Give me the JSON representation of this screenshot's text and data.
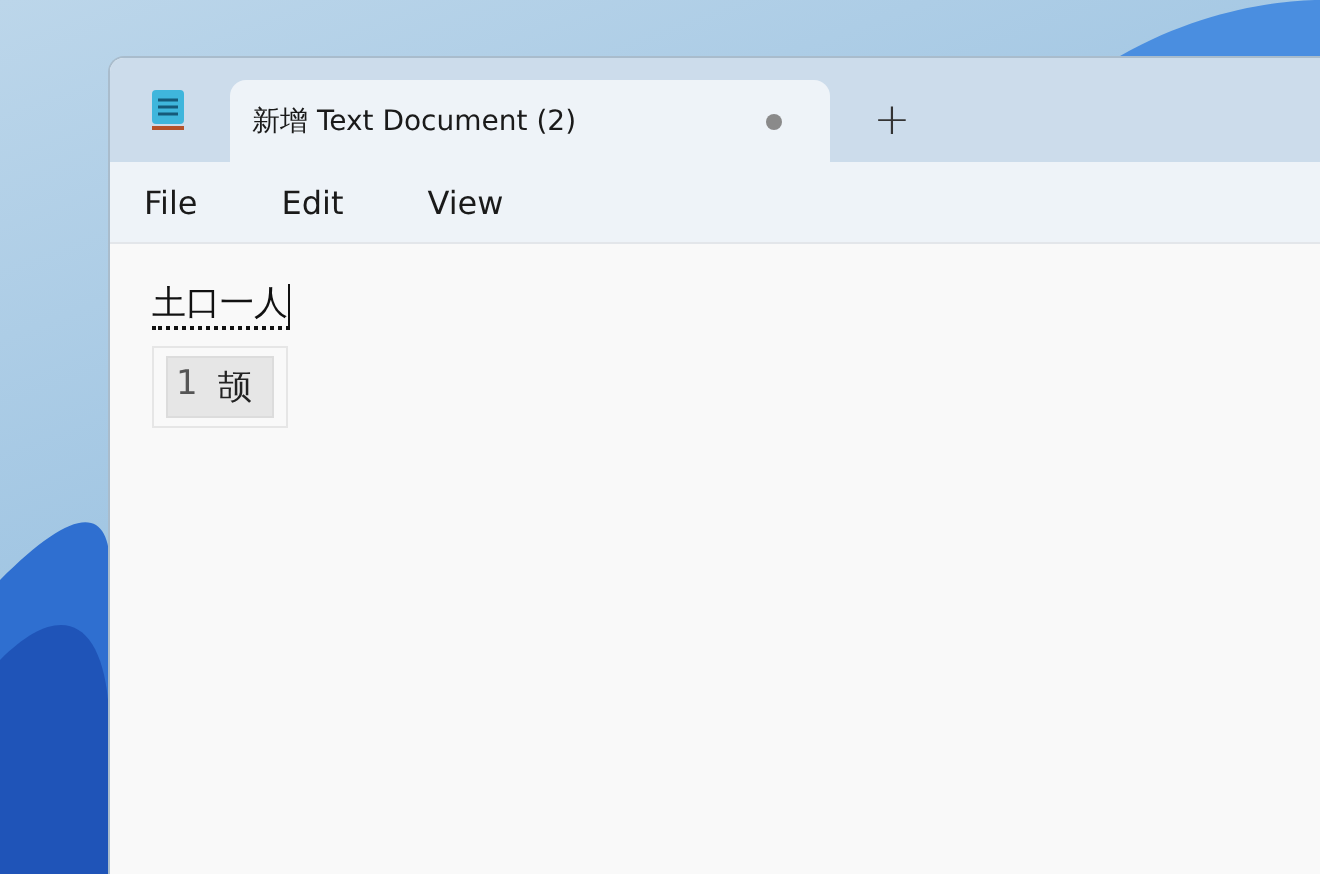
{
  "tabs": [
    {
      "title": "新增 Text Document (2)",
      "selected": true,
      "modified": true
    }
  ],
  "new_tab_button": "+",
  "menu": [
    "File",
    "Edit",
    "View"
  ],
  "editor": {
    "composition": "土口一人",
    "candidates": [
      {
        "number": "1",
        "text": "颉",
        "selected": true
      }
    ]
  }
}
